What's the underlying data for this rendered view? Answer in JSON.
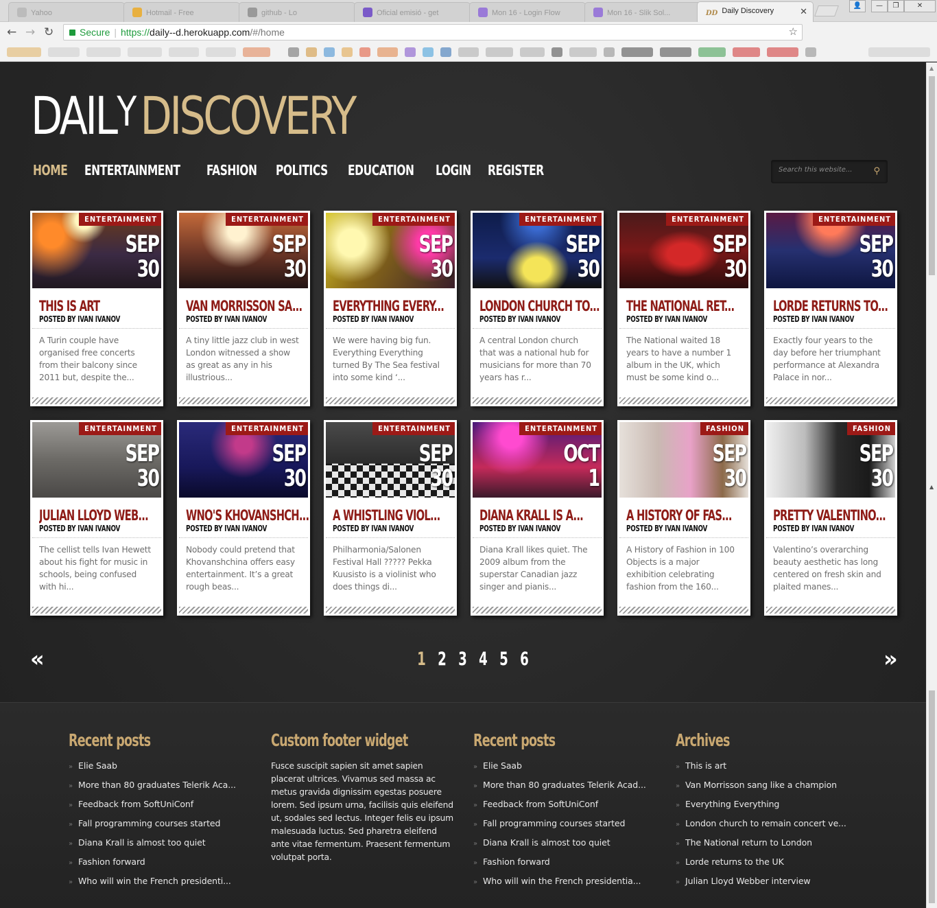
{
  "browser": {
    "tabs": [
      {
        "label": "Yahoo"
      },
      {
        "label": "Hotmail - Free"
      },
      {
        "label": "github - Lo"
      },
      {
        "label": "Oficial emisió - get"
      },
      {
        "label": "Mon 16 - Login Flow"
      },
      {
        "label": "Mon 16 - Slik Sol..."
      },
      {
        "label": "Daily Discovery",
        "favicon": "DD"
      }
    ],
    "secure_label": "Secure",
    "url_protocol": "https://",
    "url_host": "daily--d.herokuapp.com",
    "url_path": "/#/home"
  },
  "site": {
    "logo_white": "DAIL",
    "logo_y": "Y",
    "logo_gold": "DISCOVERY",
    "nav": [
      {
        "label": "HOME",
        "active": true
      },
      {
        "label": "ENTERTAINMENT"
      },
      {
        "label": "FASHION"
      },
      {
        "label": "POLITICS"
      },
      {
        "label": "EDUCATION"
      },
      {
        "label": "LOGIN"
      },
      {
        "label": "REGISTER"
      }
    ],
    "search_placeholder": "Search this website...",
    "accent": "#d6bc8a",
    "category_color": "#9c1a17",
    "title_color": "#8e1c17"
  },
  "posts": [
    {
      "category": "ENTERTAINMENT",
      "month": "SEP",
      "day": "30",
      "title": "THIS IS ART",
      "author": "POSTED BY IVAN IVANOV",
      "excerpt": "A Turin couple have organised free concerts from their balcony since 2011 but, despite the..."
    },
    {
      "category": "ENTERTAINMENT",
      "month": "SEP",
      "day": "30",
      "title": "VAN MORRISSON SA...",
      "author": "POSTED BY IVAN IVANOV",
      "excerpt": "A tiny little jazz club in west London witnessed a show as great as any in his illustrious..."
    },
    {
      "category": "ENTERTAINMENT",
      "month": "SEP",
      "day": "30",
      "title": "EVERYTHING EVERY...",
      "author": "POSTED BY IVAN IVANOV",
      "excerpt": "We were having big fun. Everything Everything turned By The Sea festival into some kind ‘..."
    },
    {
      "category": "ENTERTAINMENT",
      "month": "SEP",
      "day": "30",
      "title": "LONDON CHURCH TO...",
      "author": "POSTED BY IVAN IVANOV",
      "excerpt": "A central London church that was a national hub for musicians for more than 70 years has r..."
    },
    {
      "category": "ENTERTAINMENT",
      "month": "SEP",
      "day": "30",
      "title": "THE NATIONAL RET...",
      "author": "POSTED BY IVAN IVANOV",
      "excerpt": "The National waited 18 years to have a number 1 album in the UK, which must be some kind o..."
    },
    {
      "category": "ENTERTAINMENT",
      "month": "SEP",
      "day": "30",
      "title": "LORDE RETURNS TO...",
      "author": "POSTED BY IVAN IVANOV",
      "excerpt": "Exactly four years to the day before her triumphant performance at Alexandra Palace in nor..."
    },
    {
      "category": "ENTERTAINMENT",
      "month": "SEP",
      "day": "30",
      "title": "JULIAN LLOYD WEB...",
      "author": "POSTED BY IVAN IVANOV",
      "excerpt": "The cellist tells Ivan Hewett about his fight for music in schools, being confused with hi..."
    },
    {
      "category": "ENTERTAINMENT",
      "month": "SEP",
      "day": "30",
      "title": "WNO'S KHOVANSHCH...",
      "author": "POSTED BY IVAN IVANOV",
      "excerpt": "Nobody could pretend that Khovanshchina offers easy entertainment. It’s a great rough beas..."
    },
    {
      "category": "ENTERTAINMENT",
      "month": "SEP",
      "day": "30",
      "title": "A WHISTLING VIOL...",
      "author": "POSTED BY IVAN IVANOV",
      "excerpt": "Philharmonia/Salonen Festival Hall ????? Pekka Kuusisto is a violinist who does things di..."
    },
    {
      "category": "ENTERTAINMENT",
      "month": "OCT",
      "day": "1",
      "title": "DIANA KRALL IS A...",
      "author": "POSTED BY IVAN IVANOV",
      "excerpt": "Diana Krall likes quiet. The 2009 album from the superstar Canadian jazz singer and pianis..."
    },
    {
      "category": "FASHION",
      "month": "SEP",
      "day": "30",
      "title": "A HISTORY OF FAS...",
      "author": "POSTED BY IVAN IVANOV",
      "excerpt": "A History of Fashion in 100 Objects is a major exhibition celebrating fashion from the 160..."
    },
    {
      "category": "FASHION",
      "month": "SEP",
      "day": "30",
      "title": "PRETTY VALENTINO...",
      "author": "POSTED BY IVAN IVANOV",
      "excerpt": "Valentino’s overarching beauty aesthetic has long centered on fresh skin and plaited manes..."
    }
  ],
  "pagination": {
    "prev": "«",
    "next": "»",
    "pages": [
      "1",
      "2",
      "3",
      "4",
      "5",
      "6"
    ],
    "current": "1"
  },
  "footer": {
    "col1": {
      "title": "Recent posts",
      "items": [
        "Elie Saab",
        "More than 80 graduates Telerik Aca...",
        "Feedback from SoftUniConf",
        "Fall programming courses started",
        "Diana Krall is almost too quiet",
        "Fashion forward",
        "Who will win the French presidenti..."
      ]
    },
    "col2": {
      "title": "Custom footer widget",
      "text": "Fusce suscipit sapien sit amet sapien placerat ultrices. Vivamus sed massa ac metus gravida dignissim egestas posuere lorem. Sed ipsum urna, facilisis quis eleifend ut, sodales sed lectus. Integer felis eu ipsum malesuada luctus. Sed pharetra eleifend ante vitae fermentum. Praesent fermentum volutpat porta."
    },
    "col3": {
      "title": "Recent posts",
      "items": [
        "Elie Saab",
        "More than 80 graduates Telerik Acad...",
        "Feedback from SoftUniConf",
        "Fall programming courses started",
        "Diana Krall is almost too quiet",
        "Fashion forward",
        "Who will win the French presidentia..."
      ]
    },
    "col4": {
      "title": "Archives",
      "items": [
        "This is art",
        "Van Morrisson sang like a champion",
        "Everything Everything",
        "London church to remain concert ve...",
        "The National return to London",
        "Lorde returns to the UK",
        "Julian Lloyd Webber interview"
      ]
    }
  }
}
